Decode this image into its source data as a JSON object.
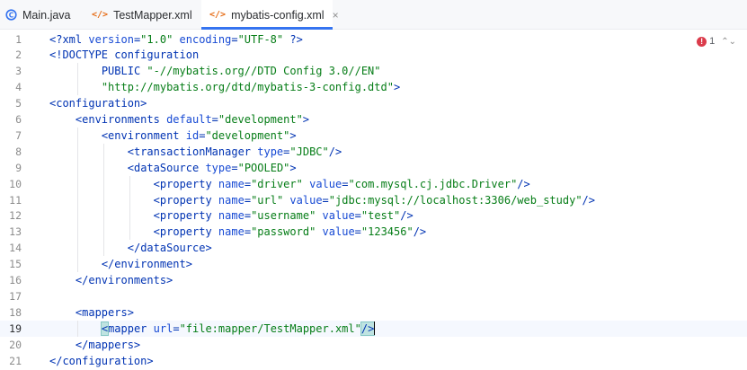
{
  "tabs": [
    {
      "label": "Main.java",
      "icon": "java-class-icon",
      "active": false
    },
    {
      "label": "TestMapper.xml",
      "icon": "xml-file-icon",
      "active": false
    },
    {
      "label": "mybatis-config.xml",
      "icon": "xml-file-icon",
      "active": true
    }
  ],
  "tab_xml_glyph": "</>",
  "tab_close": "×",
  "inspections": {
    "error_icon": "!",
    "error_count": "1",
    "nav": "⌃⌄"
  },
  "colors": {
    "accent": "#3574f0",
    "tag": "#0033b3",
    "attr": "#174ad4",
    "value": "#067d17",
    "error": "#db3b4b"
  },
  "current_line": 19,
  "lines": [
    {
      "n": "1",
      "indent": 0,
      "parts": [
        [
          "pi",
          "<?xml "
        ],
        [
          "aname",
          "version"
        ],
        [
          "pi",
          "="
        ],
        [
          "aval",
          "\"1.0\""
        ],
        [
          "pi",
          " "
        ],
        [
          "aname",
          "encoding"
        ],
        [
          "pi",
          "="
        ],
        [
          "aval",
          "\"UTF-8\""
        ],
        [
          "pi",
          " ?>"
        ]
      ]
    },
    {
      "n": "2",
      "indent": 0,
      "parts": [
        [
          "tag",
          "<!DOCTYPE configuration"
        ]
      ]
    },
    {
      "n": "3",
      "indent": 2,
      "parts": [
        [
          "tag",
          "PUBLIC "
        ],
        [
          "aval",
          "\"-//mybatis.org//DTD Config 3.0//EN\""
        ]
      ]
    },
    {
      "n": "4",
      "indent": 2,
      "parts": [
        [
          "aval",
          "\"http://mybatis.org/dtd/mybatis-3-config.dtd\""
        ],
        [
          "tag",
          ">"
        ]
      ]
    },
    {
      "n": "5",
      "indent": 0,
      "parts": [
        [
          "tag",
          "<configuration>"
        ]
      ]
    },
    {
      "n": "6",
      "indent": 1,
      "parts": [
        [
          "tag",
          "<environments "
        ],
        [
          "aname",
          "default"
        ],
        [
          "tag",
          "="
        ],
        [
          "aval",
          "\"development\""
        ],
        [
          "tag",
          ">"
        ]
      ]
    },
    {
      "n": "7",
      "indent": 2,
      "parts": [
        [
          "tag",
          "<environment "
        ],
        [
          "aname",
          "id"
        ],
        [
          "tag",
          "="
        ],
        [
          "aval",
          "\"development\""
        ],
        [
          "tag",
          ">"
        ]
      ]
    },
    {
      "n": "8",
      "indent": 3,
      "parts": [
        [
          "tag",
          "<transactionManager "
        ],
        [
          "aname",
          "type"
        ],
        [
          "tag",
          "="
        ],
        [
          "aval",
          "\"JDBC\""
        ],
        [
          "tag",
          "/>"
        ]
      ]
    },
    {
      "n": "9",
      "indent": 3,
      "parts": [
        [
          "tag",
          "<dataSource "
        ],
        [
          "aname",
          "type"
        ],
        [
          "tag",
          "="
        ],
        [
          "aval",
          "\"POOLED\""
        ],
        [
          "tag",
          ">"
        ]
      ]
    },
    {
      "n": "10",
      "indent": 4,
      "parts": [
        [
          "tag",
          "<property "
        ],
        [
          "aname",
          "name"
        ],
        [
          "tag",
          "="
        ],
        [
          "aval",
          "\"driver\""
        ],
        [
          "tag",
          " "
        ],
        [
          "aname",
          "value"
        ],
        [
          "tag",
          "="
        ],
        [
          "aval",
          "\"com.mysql.cj.jdbc.Driver\""
        ],
        [
          "tag",
          "/>"
        ]
      ]
    },
    {
      "n": "11",
      "indent": 4,
      "parts": [
        [
          "tag",
          "<property "
        ],
        [
          "aname",
          "name"
        ],
        [
          "tag",
          "="
        ],
        [
          "aval",
          "\"url\""
        ],
        [
          "tag",
          " "
        ],
        [
          "aname",
          "value"
        ],
        [
          "tag",
          "="
        ],
        [
          "aval",
          "\"jdbc:mysql://localhost:3306/web_study\""
        ],
        [
          "tag",
          "/>"
        ]
      ]
    },
    {
      "n": "12",
      "indent": 4,
      "parts": [
        [
          "tag",
          "<property "
        ],
        [
          "aname",
          "name"
        ],
        [
          "tag",
          "="
        ],
        [
          "aval",
          "\"username\""
        ],
        [
          "tag",
          " "
        ],
        [
          "aname",
          "value"
        ],
        [
          "tag",
          "="
        ],
        [
          "aval",
          "\"test\""
        ],
        [
          "tag",
          "/>"
        ]
      ]
    },
    {
      "n": "13",
      "indent": 4,
      "parts": [
        [
          "tag",
          "<property "
        ],
        [
          "aname",
          "name"
        ],
        [
          "tag",
          "="
        ],
        [
          "aval",
          "\"password\""
        ],
        [
          "tag",
          " "
        ],
        [
          "aname",
          "value"
        ],
        [
          "tag",
          "="
        ],
        [
          "aval",
          "\"123456\""
        ],
        [
          "tag",
          "/>"
        ]
      ]
    },
    {
      "n": "14",
      "indent": 3,
      "parts": [
        [
          "tag",
          "</dataSource>"
        ]
      ]
    },
    {
      "n": "15",
      "indent": 2,
      "parts": [
        [
          "tag",
          "</environment>"
        ]
      ]
    },
    {
      "n": "16",
      "indent": 1,
      "parts": [
        [
          "tag",
          "</environments>"
        ]
      ]
    },
    {
      "n": "17",
      "indent": 0,
      "parts": []
    },
    {
      "n": "18",
      "indent": 1,
      "parts": [
        [
          "tag",
          "<mappers>"
        ]
      ]
    },
    {
      "n": "19",
      "indent": 2,
      "parts": [
        [
          "tag mark",
          "<"
        ],
        [
          "tag",
          "mapper "
        ],
        [
          "aname",
          "url"
        ],
        [
          "tag",
          "="
        ],
        [
          "aval",
          "\"file:mapper/TestMapper.xml\""
        ],
        [
          "tag mark",
          "/>"
        ]
      ]
    },
    {
      "n": "20",
      "indent": 1,
      "parts": [
        [
          "tag",
          "</mappers>"
        ]
      ]
    },
    {
      "n": "21",
      "indent": 0,
      "parts": [
        [
          "tag",
          "</configuration>"
        ]
      ]
    }
  ]
}
